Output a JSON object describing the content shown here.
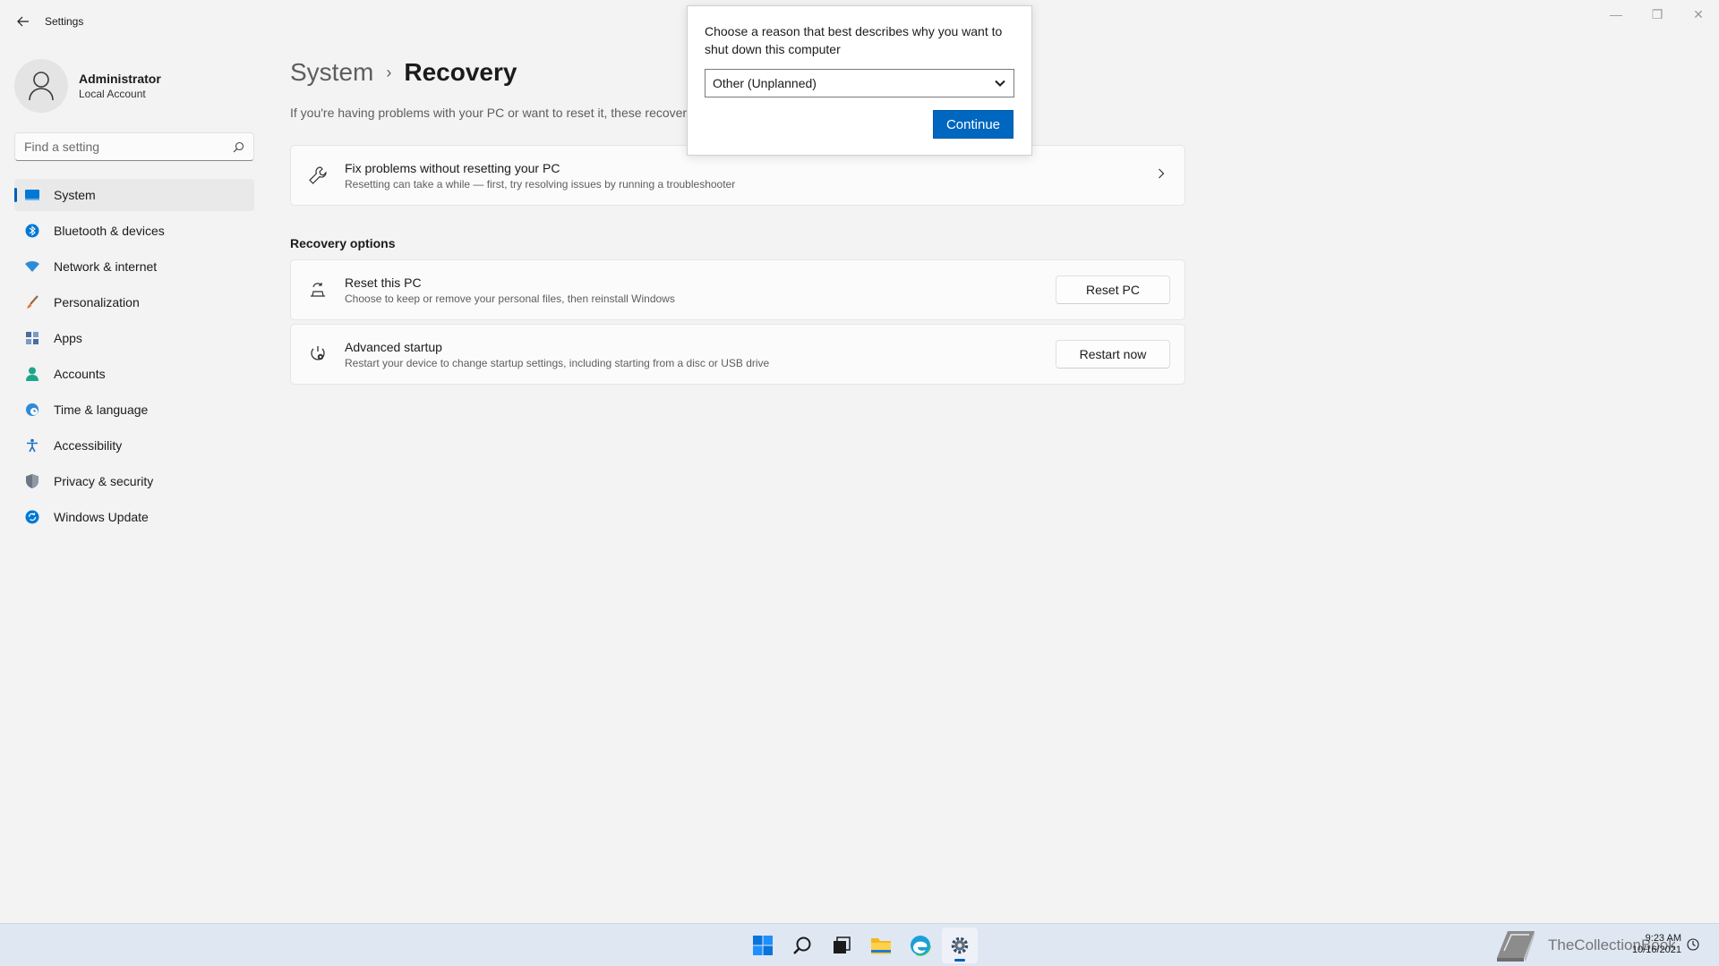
{
  "window": {
    "app_title": "Settings",
    "minimize": "—",
    "maximize": "❐",
    "close": "✕"
  },
  "profile": {
    "name": "Administrator",
    "account_type": "Local Account"
  },
  "search": {
    "placeholder": "Find a setting"
  },
  "nav": {
    "items": [
      {
        "label": "System",
        "icon": "monitor-icon",
        "color": "#0078d4"
      },
      {
        "label": "Bluetooth & devices",
        "icon": "bluetooth-icon",
        "color": "#0078d4"
      },
      {
        "label": "Network & internet",
        "icon": "wifi-icon",
        "color": "#2e8bd8"
      },
      {
        "label": "Personalization",
        "icon": "brush-icon",
        "color": "#e07a3a"
      },
      {
        "label": "Apps",
        "icon": "apps-icon",
        "color": "#4a6e9c"
      },
      {
        "label": "Accounts",
        "icon": "person-icon",
        "color": "#1ba68c"
      },
      {
        "label": "Time & language",
        "icon": "globe-clock-icon",
        "color": "#2e8bd8"
      },
      {
        "label": "Accessibility",
        "icon": "accessibility-icon",
        "color": "#1f6fc5"
      },
      {
        "label": "Privacy & security",
        "icon": "shield-icon",
        "color": "#6b7785"
      },
      {
        "label": "Windows Update",
        "icon": "update-icon",
        "color": "#0078d4"
      }
    ],
    "active_index": 0
  },
  "breadcrumb": {
    "parent": "System",
    "separator": "›",
    "current": "Recovery"
  },
  "intro_text": "If you're having problems with your PC or want to reset it, these recover",
  "fix_card": {
    "title": "Fix problems without resetting your PC",
    "description": "Resetting can take a while — first, try resolving issues by running a troubleshooter"
  },
  "recovery_options": {
    "heading": "Recovery options",
    "reset": {
      "title": "Reset this PC",
      "description": "Choose to keep or remove your personal files, then reinstall Windows",
      "button": "Reset PC"
    },
    "advanced": {
      "title": "Advanced startup",
      "description": "Restart your device to change startup settings, including starting from a disc or USB drive",
      "button": "Restart now"
    }
  },
  "shutdown_dialog": {
    "message": "Choose a reason that best describes why you want to shut down this computer",
    "selected_reason": "Other (Unplanned)",
    "continue_label": "Continue"
  },
  "taskbar": {
    "apps": [
      "windows-start-icon",
      "search-icon",
      "task-view-icon",
      "file-explorer-icon",
      "edge-icon",
      "settings-gear-icon"
    ],
    "active_app": "settings-gear-icon",
    "watermark": "TheCollectionBook",
    "time": "9:23 AM",
    "date": "10/16/2021"
  },
  "colors": {
    "accent": "#005fb8",
    "button_primary": "#0067c0",
    "background": "#f3f3f3",
    "card": "#fbfbfb"
  }
}
